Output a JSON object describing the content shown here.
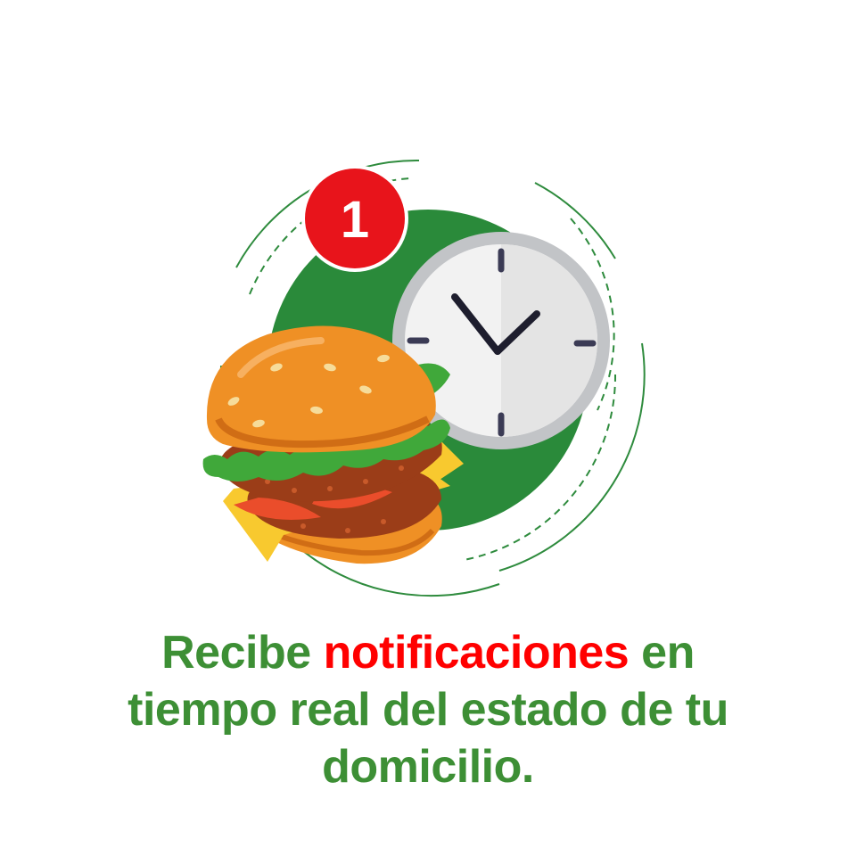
{
  "badge": {
    "count": "1"
  },
  "caption": {
    "line1_part1": "Recibe ",
    "line1_highlight": "notificaciones",
    "line1_part2": " en",
    "line2": "tiempo real del estado de tu",
    "line3": "domicilio."
  },
  "colors": {
    "green": "#2e8b3d",
    "dark_green": "#2a8a3a",
    "red": "#ff0000",
    "badge_red": "#e8141b",
    "clock_face": "#f2f2f2",
    "clock_rim": "#b7b9bd",
    "bun": "#ef9025",
    "patty": "#9b3d18",
    "lettuce": "#40a83a",
    "cheese": "#f8c92f",
    "tomato": "#ea4d2b"
  },
  "icons": [
    "notification-badge",
    "clock-icon",
    "burger-icon"
  ]
}
